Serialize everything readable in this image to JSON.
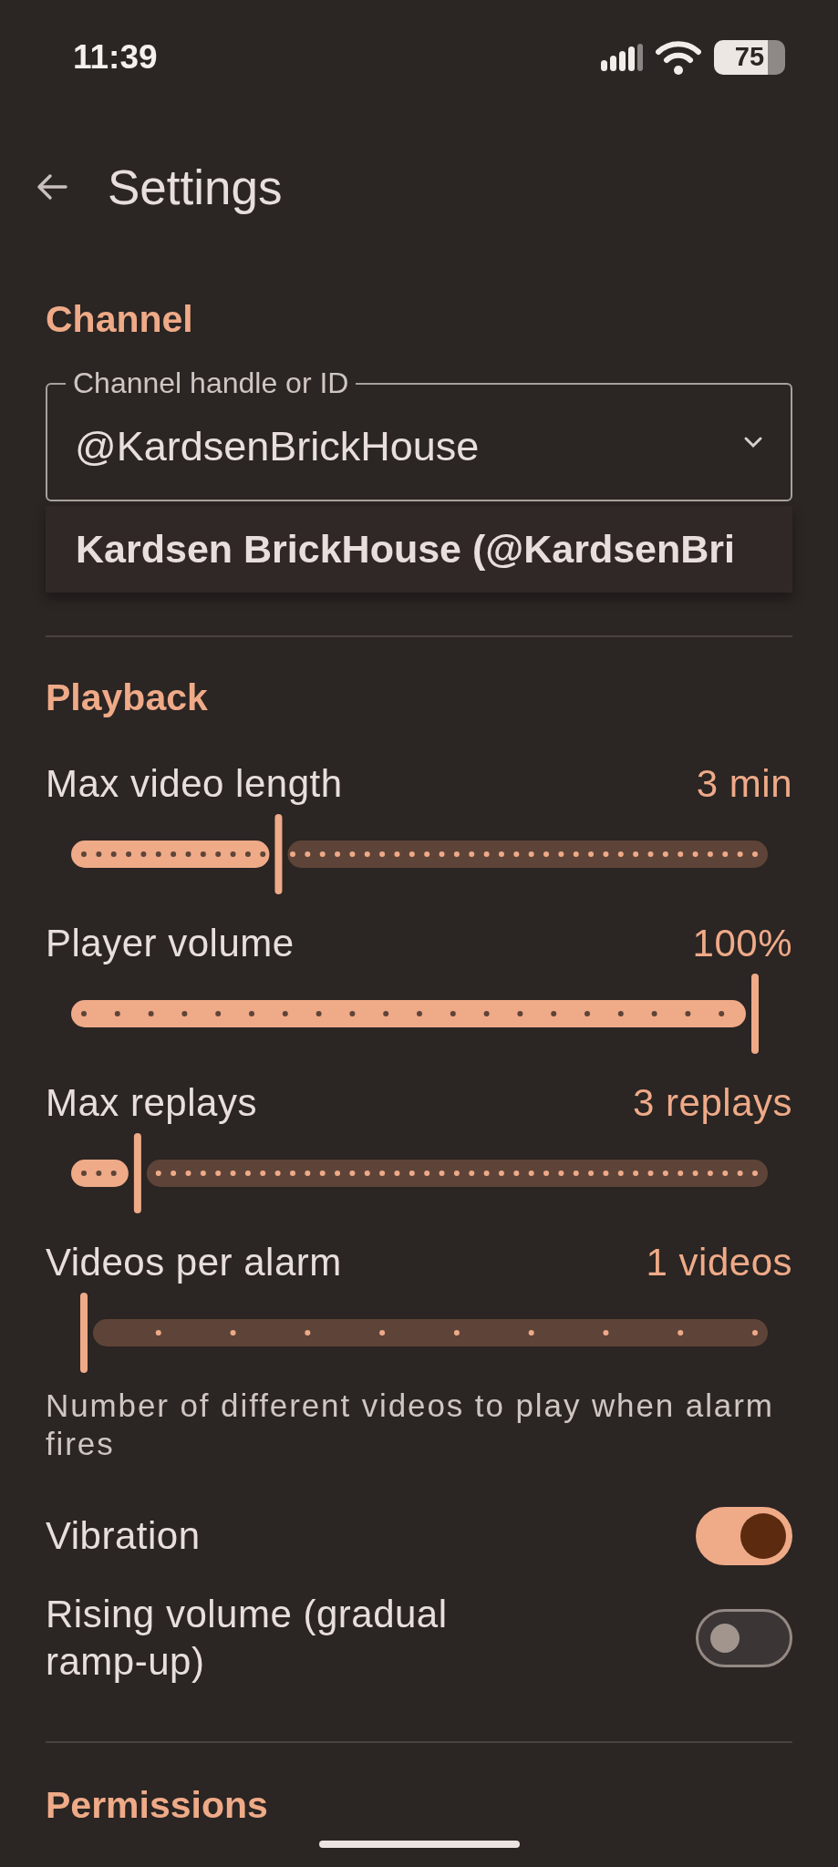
{
  "status_bar": {
    "time": "11:39",
    "battery": "75"
  },
  "header": {
    "title": "Settings"
  },
  "channel": {
    "title": "Channel",
    "field": {
      "label": "Channel handle or ID",
      "value": "@KardsenBrickHouse"
    },
    "suggestions": [
      "Kardsen BrickHouse (@KardsenBri"
    ]
  },
  "playback": {
    "title": "Playback",
    "sliders": [
      {
        "label": "Max video length",
        "reading": "3 min",
        "level": 0.29
      },
      {
        "label": "Player volume",
        "reading": "100%",
        "level": 1.0
      },
      {
        "label": "Max replays",
        "reading": "3 replays",
        "level": 0.08
      },
      {
        "label": "Videos per alarm",
        "reading": "1 videos",
        "level": 0.0
      }
    ],
    "helper": "Number of different videos to play when alarm fires",
    "toggles": [
      {
        "label": "Vibration",
        "on": true
      },
      {
        "label": "Rising volume (gradual ramp-up)",
        "on": false
      }
    ]
  },
  "permissions": {
    "title": "Permissions"
  }
}
